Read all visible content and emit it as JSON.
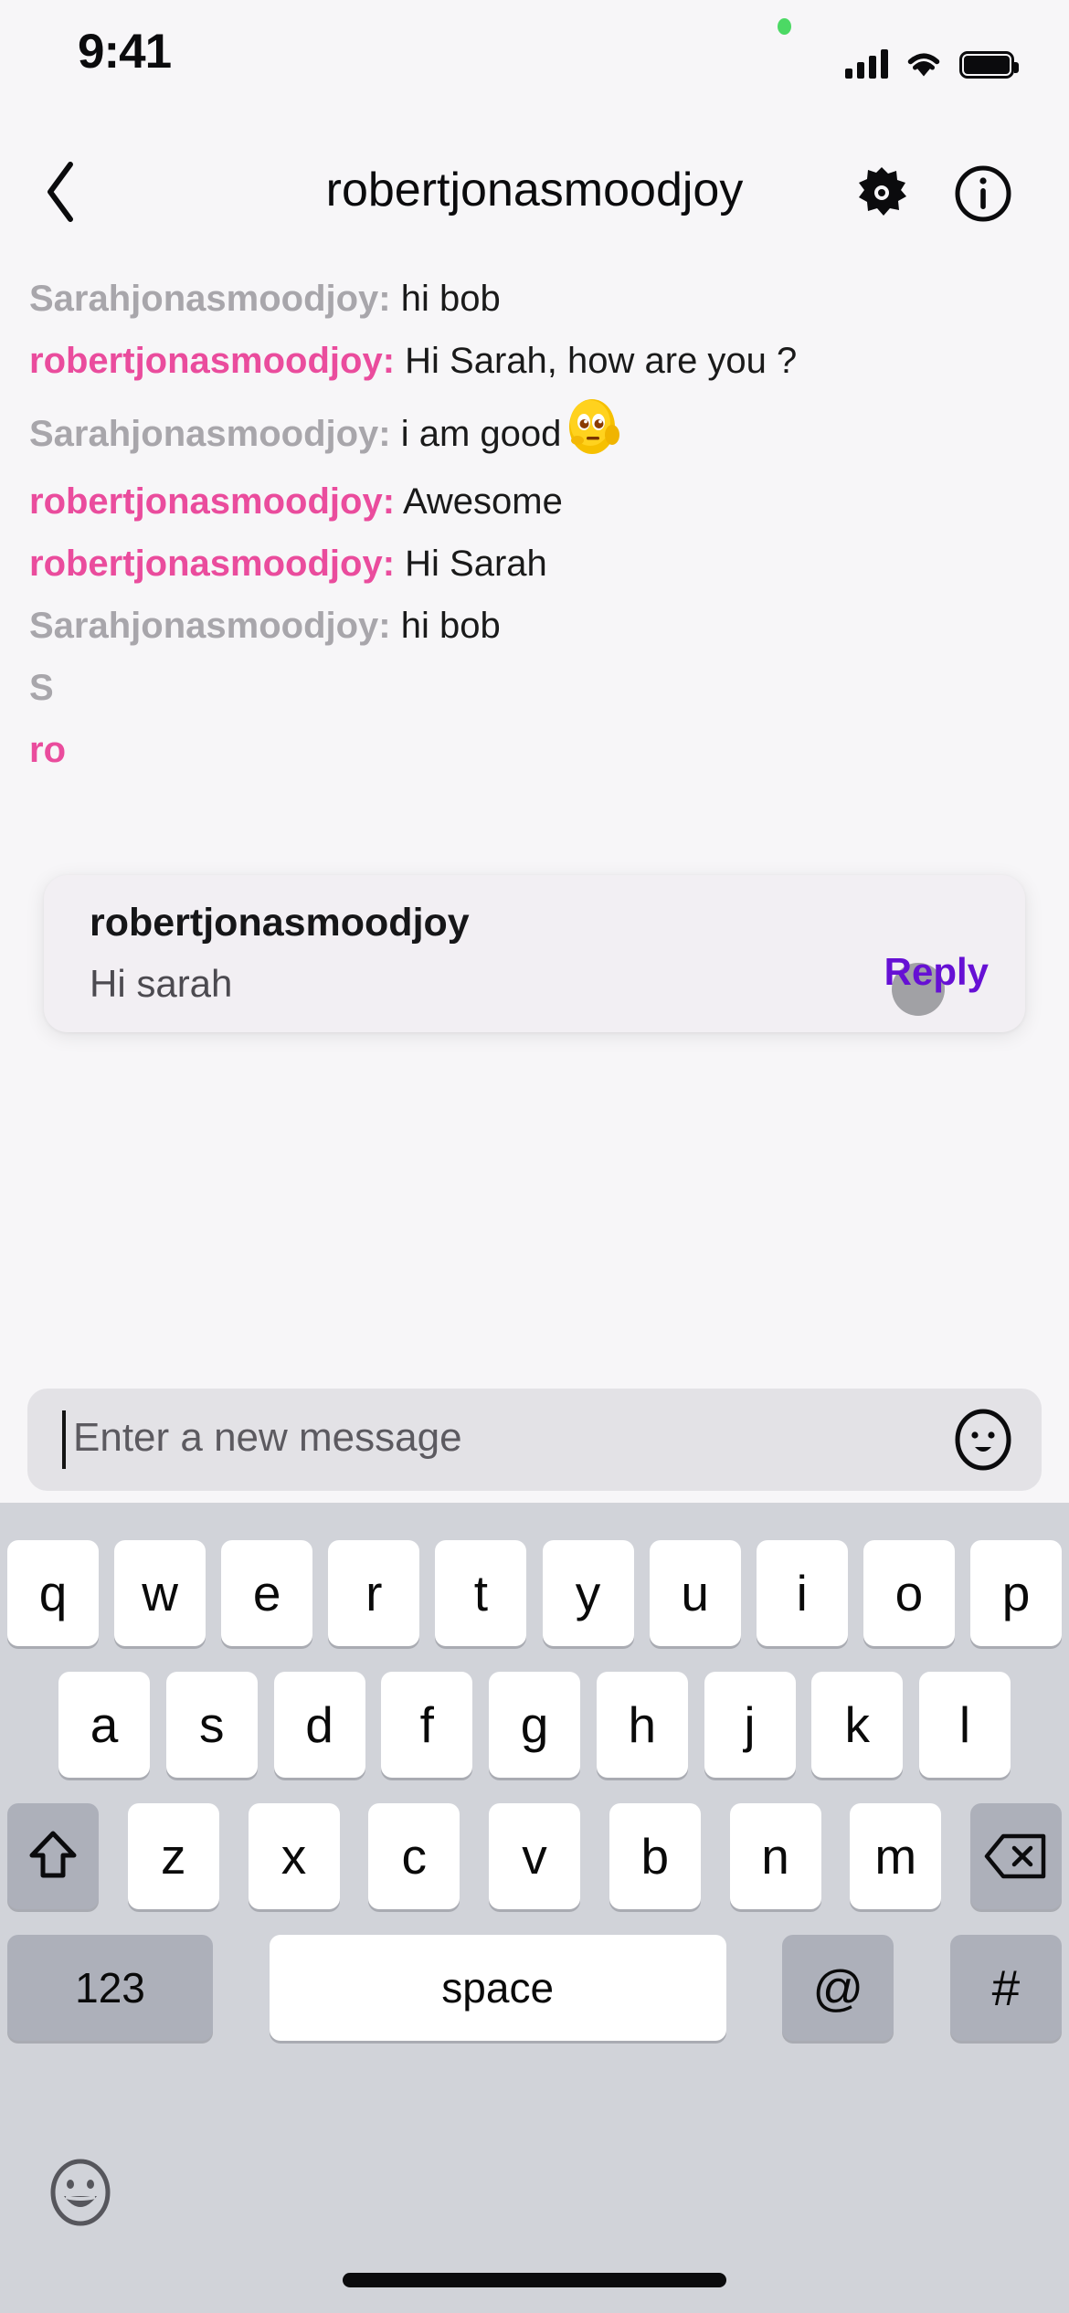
{
  "status_bar": {
    "time": "9:41",
    "recording_dot": "recording-indicator",
    "icons": [
      "cellular-signal-icon",
      "wifi-icon",
      "battery-icon"
    ]
  },
  "nav_bar": {
    "back_icon": "chevron-left-icon",
    "title": "robertjonasmoodjoy",
    "settings_icon": "gear-icon",
    "info_icon": "info-circle-icon"
  },
  "conversation": {
    "messages": [
      {
        "sender": "Sarahjonasmoodjoy:",
        "text": "hi bob",
        "side": "them",
        "emoji": ""
      },
      {
        "sender": "robertjonasmoodjoy:",
        "text": "Hi Sarah, how are you ?",
        "side": "me",
        "emoji": ""
      },
      {
        "sender": "Sarahjonasmoodjoy:",
        "text": "i am good",
        "side": "them",
        "emoji": "smiling-face-emoji"
      },
      {
        "sender": "robertjonasmoodjoy:",
        "text": "Awesome",
        "side": "me",
        "emoji": ""
      },
      {
        "sender": "robertjonasmoodjoy:",
        "text": "Hi Sarah",
        "side": "me",
        "emoji": ""
      },
      {
        "sender": "Sarahjonasmoodjoy:",
        "text": "hi bob",
        "side": "them",
        "emoji": ""
      },
      {
        "sender": "S",
        "text": "",
        "side": "them",
        "emoji": ""
      },
      {
        "sender": "ro",
        "text": "",
        "side": "me",
        "emoji": ""
      }
    ]
  },
  "notification": {
    "title": "robertjonasmoodjoy",
    "body": "Hi sarah",
    "reply_label": "Reply",
    "touch_indicator": "touch-point-indicator"
  },
  "message_input": {
    "value": "",
    "placeholder": "Enter a new message",
    "emoji_icon": "smiley-face-icon"
  },
  "keyboard": {
    "row1": [
      "q",
      "w",
      "e",
      "r",
      "t",
      "y",
      "u",
      "i",
      "o",
      "p"
    ],
    "row2": [
      "a",
      "s",
      "d",
      "f",
      "g",
      "h",
      "j",
      "k",
      "l"
    ],
    "row3_letters": [
      "z",
      "x",
      "c",
      "v",
      "b",
      "n",
      "m"
    ],
    "shift_icon": "shift-arrow-icon",
    "backspace_icon": "backspace-icon",
    "numbers_label": "123",
    "space_label": "space",
    "at_label": "@",
    "hash_label": "#",
    "emoji_key_icon": "emoji-smiley-icon"
  },
  "home_indicator": "home-indicator-bar",
  "colors": {
    "background": "#f7f6f8",
    "me_username": "#ea4c9d",
    "them_username": "#a8a6ab",
    "reply_purple": "#6610d4",
    "keyboard_bg": "#d1d3d9",
    "key_white": "#ffffff",
    "key_dark": "#adb0ba",
    "input_bg": "#e3e2e6",
    "notif_bg": "#f2eff3",
    "recording_green": "#4cd964"
  }
}
